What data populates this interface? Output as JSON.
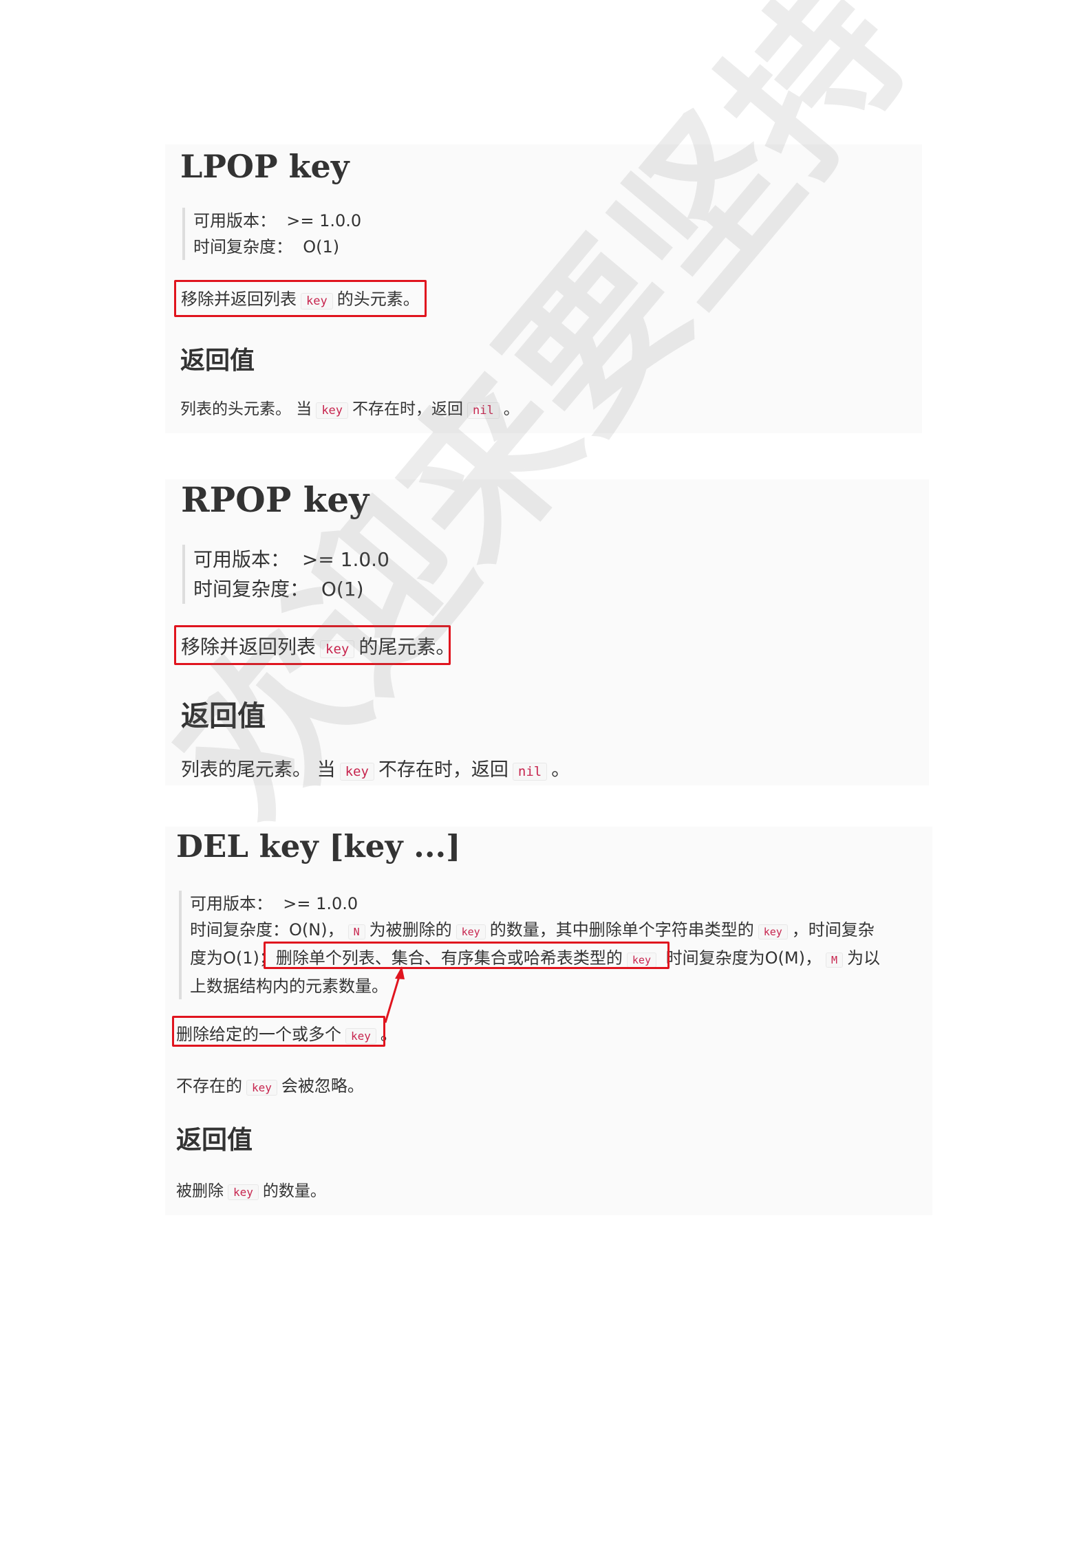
{
  "lpop": {
    "title": "LPOP key",
    "version_label": "可用版本：",
    "version_value": ">= 1.0.0",
    "complexity_label": "时间复杂度：",
    "complexity_value": "O(1)",
    "desc_pre": "移除并返回列表",
    "desc_code": "key",
    "desc_post": "的头元素。",
    "return_heading": "返回值",
    "return_pre": "列表的头元素。 当",
    "return_code1": "key",
    "return_mid": "不存在时，返回",
    "return_code2": "nil",
    "return_post": "。"
  },
  "rpop": {
    "title": "RPOP key",
    "version_label": "可用版本：",
    "version_value": ">= 1.0.0",
    "complexity_label": "时间复杂度：",
    "complexity_value": "O(1)",
    "desc_pre": "移除并返回列表",
    "desc_code": "key",
    "desc_post": "的尾元素。",
    "return_heading": "返回值",
    "return_pre": "列表的尾元素。 当",
    "return_code1": "key",
    "return_mid": "不存在时，返回",
    "return_code2": "nil",
    "return_post": "。"
  },
  "del": {
    "title": "DEL key [key ...]",
    "version_label": "可用版本：",
    "version_value": ">= 1.0.0",
    "c_l1_a": "时间复杂度：O(N)，",
    "c_l1_code1": "N",
    "c_l1_b": "为被删除的",
    "c_l1_code2": "key",
    "c_l1_c": "的数量，其中删除单个字符串类型的",
    "c_l1_code3": "key",
    "c_l1_d": "，时间复杂",
    "c_l2_a": "度为O(1)；",
    "c_l2_b": "删除单个列表、集合、有序集合或哈希表类型的",
    "c_l2_code1": "key",
    "c_l2_c": "时间复杂度为O(M)，",
    "c_l2_code2": "M",
    "c_l2_d": "为以",
    "c_l3": "上数据结构内的元素数量。",
    "desc_pre": "删除给定的一个或多个",
    "desc_code": "key",
    "desc_post": "。",
    "ignore_pre": "不存在的",
    "ignore_code": "key",
    "ignore_post": "会被忽略。",
    "return_heading": "返回值",
    "return_pre": "被删除",
    "return_code": "key",
    "return_post": "的数量。"
  },
  "watermark": "欢迎来要坚持",
  "colors": {
    "highlight_box": "#e0141e",
    "code_text": "#c7254e",
    "card_bg": "#fafafa"
  }
}
